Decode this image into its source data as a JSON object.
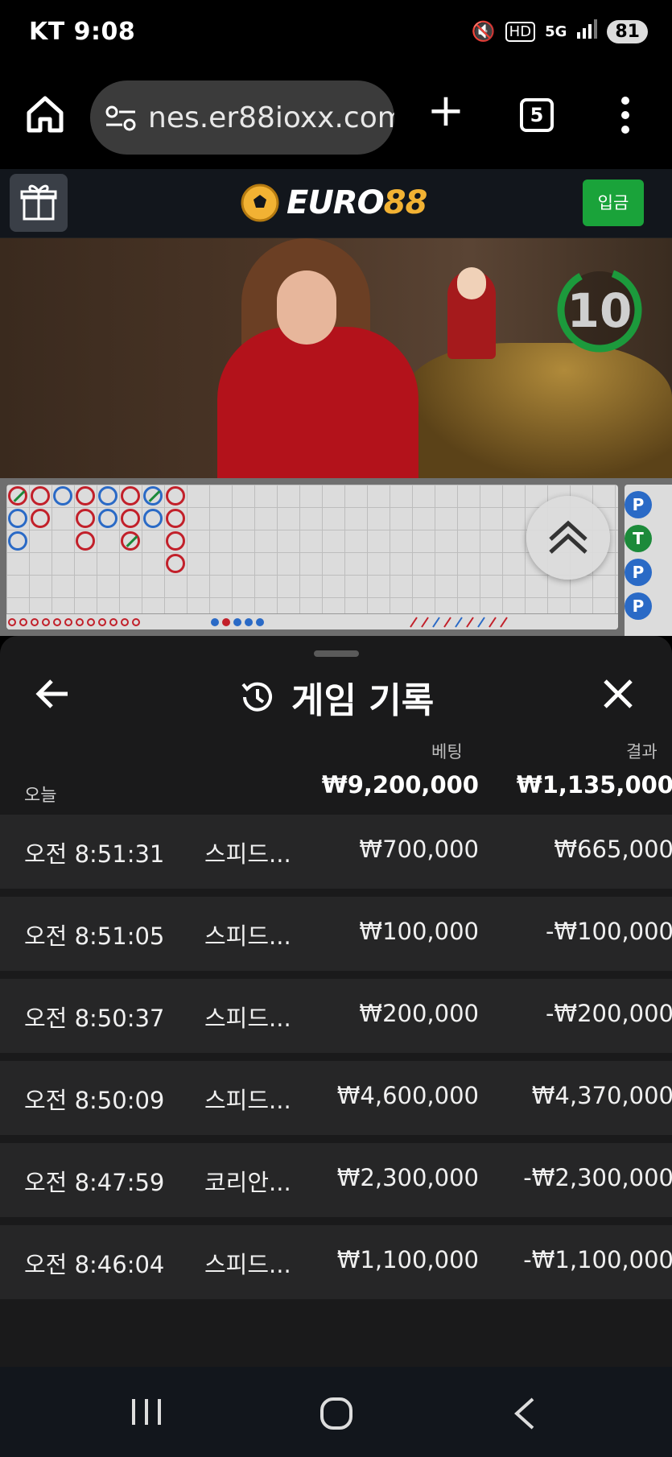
{
  "status_bar": {
    "carrier_time": "KT 9:08",
    "network": "5G",
    "hd": "HD",
    "battery": "81"
  },
  "browser": {
    "url": "nes.er88ioxx.com",
    "tab_count": "5"
  },
  "site_header": {
    "logo_prefix": "EURO",
    "logo_suffix": "88",
    "deposit_label": "입금",
    "accent_green": "#1aa33a",
    "accent_gold": "#f2b233"
  },
  "live_video": {
    "countdown": "10"
  },
  "roadmap": {
    "bead_chips": [
      "P",
      "T",
      "P",
      "P"
    ]
  },
  "history_sheet": {
    "title": "게임 기록",
    "col_bet": "베팅",
    "col_result": "결과",
    "summary_label": "오늘",
    "summary_bet": "₩9,200,000",
    "summary_result": "₩1,135,000",
    "rows": [
      {
        "time": "오전 8:51:31",
        "game": "스피드...",
        "bet": "₩700,000",
        "result": "₩665,000"
      },
      {
        "time": "오전 8:51:05",
        "game": "스피드...",
        "bet": "₩100,000",
        "result": "-₩100,000"
      },
      {
        "time": "오전 8:50:37",
        "game": "스피드...",
        "bet": "₩200,000",
        "result": "-₩200,000"
      },
      {
        "time": "오전 8:50:09",
        "game": "스피드...",
        "bet": "₩4,600,000",
        "result": "₩4,370,000"
      },
      {
        "time": "오전 8:47:59",
        "game": "코리안...",
        "bet": "₩2,300,000",
        "result": "-₩2,300,000"
      },
      {
        "time": "오전 8:46:04",
        "game": "스피드...",
        "bet": "₩1,100,000",
        "result": "-₩1,100,000"
      }
    ]
  }
}
